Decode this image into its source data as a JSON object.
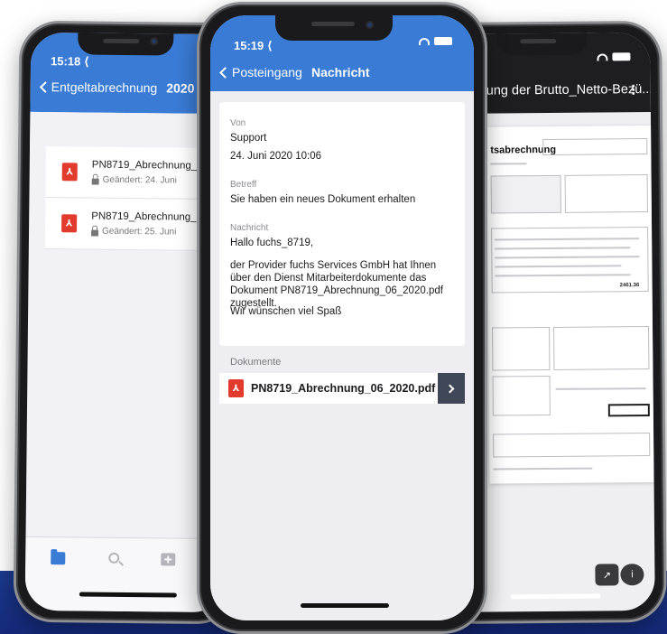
{
  "left_screen": {
    "status_time": "15:18 ⟨",
    "back_label": "Entgeltabrechnung",
    "year": "2020",
    "documents": [
      {
        "name": "PN8719_Abrechnung_06_20",
        "meta": "Geändert: 24. Juni"
      },
      {
        "name": "PN8719_Abrechnung_06_20",
        "meta": "Geändert: 25. Juni"
      }
    ],
    "tabs": [
      "folder-icon",
      "search-icon",
      "add-icon"
    ]
  },
  "middle_screen": {
    "status_time": "15:19 ⟨",
    "back_label": "Posteingang",
    "title": "Nachricht",
    "from_label": "Von",
    "sender": "Support",
    "date": "24. Juni 2020 10:06",
    "subject_label": "Betreff",
    "subject": "Sie haben ein neues Dokument erhalten",
    "message_label": "Nachricht",
    "greeting": "Hallo fuchs_8719,",
    "body": "der Provider fuchs Services GmbH hat Ihnen über den Dienst Mitarbeiterdokumente das Dokument PN8719_Abrechnung_06_2020.pdf zugestellt.",
    "closing": "Wir wünschen viel Spaß",
    "documents_label": "Dokumente",
    "attachment": "PN8719_Abrechnung_06_2020.pdf"
  },
  "right_screen": {
    "doc_title": "ung der Brutto_Netto-Bezü...",
    "more_label": "⋮",
    "pdf_heading": "tsabrechnung",
    "pdf_total": "2461.36",
    "share_icon": "↗",
    "info_icon": "i"
  },
  "colors": {
    "nav_blue": "#3a7bd5",
    "pdf_red": "#e23b2e",
    "band_blue": "#14297a"
  }
}
